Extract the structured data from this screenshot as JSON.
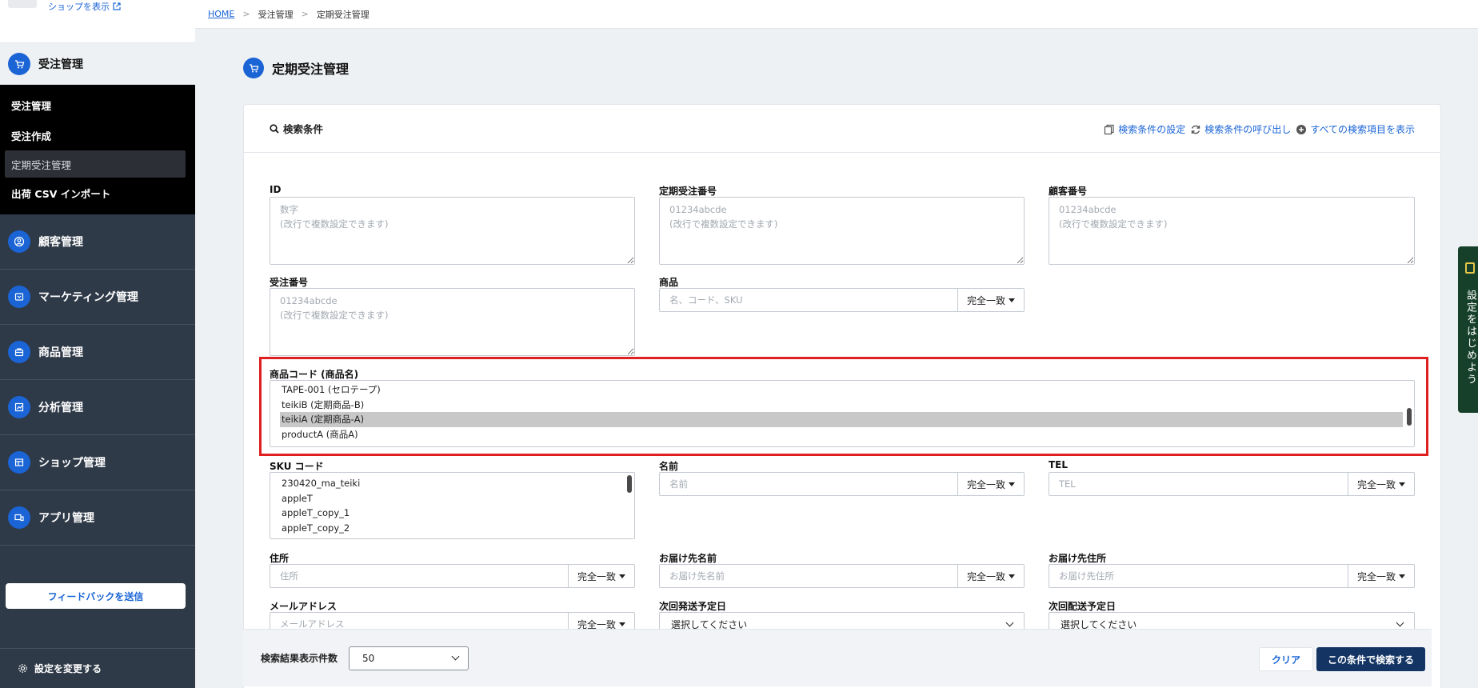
{
  "sidebar": {
    "shop_link": "ショップを表示",
    "section_title": "受注管理",
    "sub_items": [
      "受注管理",
      "受注作成",
      "定期受注管理",
      "出荷 CSV インポート"
    ],
    "items": [
      {
        "label": "顧客管理"
      },
      {
        "label": "マーケティング管理"
      },
      {
        "label": "商品管理"
      },
      {
        "label": "分析管理"
      },
      {
        "label": "ショップ管理"
      },
      {
        "label": "アプリ管理"
      }
    ],
    "feedback": "フィードバックを送信",
    "settings": "設定を変更する"
  },
  "breadcrumb": {
    "home": "HOME",
    "level1": "受注管理",
    "current": "定期受注管理"
  },
  "page_title": "定期受注管理",
  "search": {
    "title": "検索条件",
    "links": {
      "settings": "検索条件の設定",
      "recall": "検索条件の呼び出し",
      "show_all": "すべての検索項目を表示"
    }
  },
  "fields": {
    "id": {
      "label": "ID",
      "placeholder": "数字\n(改行で複数設定できます)"
    },
    "subscription_no": {
      "label": "定期受注番号",
      "placeholder": "01234abcde\n(改行で複数設定できます)"
    },
    "customer_no": {
      "label": "顧客番号",
      "placeholder": "01234abcde\n(改行で複数設定できます)"
    },
    "order_no": {
      "label": "受注番号",
      "placeholder": "01234abcde\n(改行で複数設定できます)"
    },
    "product": {
      "label": "商品",
      "placeholder": "名、コード、SKU",
      "match": "完全一致"
    },
    "product_code": {
      "label": "商品コード (商品名)",
      "options": [
        "TAPE-001 (セロテープ)",
        "teikiB (定期商品-B)",
        "teikiA (定期商品-A)",
        "productA (商品A)"
      ],
      "selected": "teikiA (定期商品-A)"
    },
    "sku": {
      "label": "SKU コード",
      "options": [
        "230420_ma_teiki",
        "appleT",
        "appleT_copy_1",
        "appleT_copy_2"
      ]
    },
    "name": {
      "label": "名前",
      "placeholder": "名前",
      "match": "完全一致"
    },
    "tel": {
      "label": "TEL",
      "placeholder": "TEL",
      "match": "完全一致"
    },
    "address": {
      "label": "住所",
      "placeholder": "住所",
      "match": "完全一致"
    },
    "ship_name": {
      "label": "お届け先名前",
      "placeholder": "お届け先名前",
      "match": "完全一致"
    },
    "ship_address": {
      "label": "お届け先住所",
      "placeholder": "お届け先住所",
      "match": "完全一致"
    },
    "email": {
      "label": "メールアドレス",
      "placeholder": "メールアドレス",
      "match": "完全一致"
    },
    "next_ship": {
      "label": "次回発送予定日",
      "value": "選択してください"
    },
    "next_delivery": {
      "label": "次回配送予定日",
      "value": "選択してください"
    }
  },
  "bottom": {
    "count_label": "検索結果表示件数",
    "count_value": "50",
    "clear": "クリア",
    "submit": "この条件で検索する"
  },
  "side_tab": "設定をはじめよう",
  "colors": {
    "primary": "#1a64d6",
    "sidebar": "#2f3a48",
    "submit": "#143464",
    "highlight": "#e02020"
  }
}
